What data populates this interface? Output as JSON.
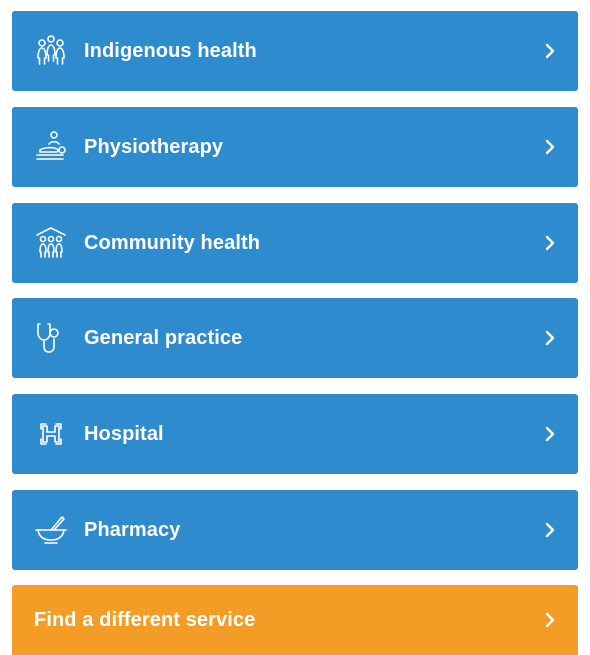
{
  "services": [
    {
      "label": "Indigenous health",
      "icon": "indigenous-people-icon"
    },
    {
      "label": "Physiotherapy",
      "icon": "physiotherapy-massage-icon"
    },
    {
      "label": "Community health",
      "icon": "community-house-people-icon"
    },
    {
      "label": "General practice",
      "icon": "stethoscope-icon"
    },
    {
      "label": "Hospital",
      "icon": "hospital-h-icon"
    },
    {
      "label": "Pharmacy",
      "icon": "mortar-pestle-icon"
    }
  ],
  "find_other": {
    "label": "Find a different service",
    "icon": "chevron-right-icon"
  },
  "colors": {
    "service_bg": "#2e8bcd",
    "find_bg": "#f39d26",
    "text": "#ffffff"
  }
}
